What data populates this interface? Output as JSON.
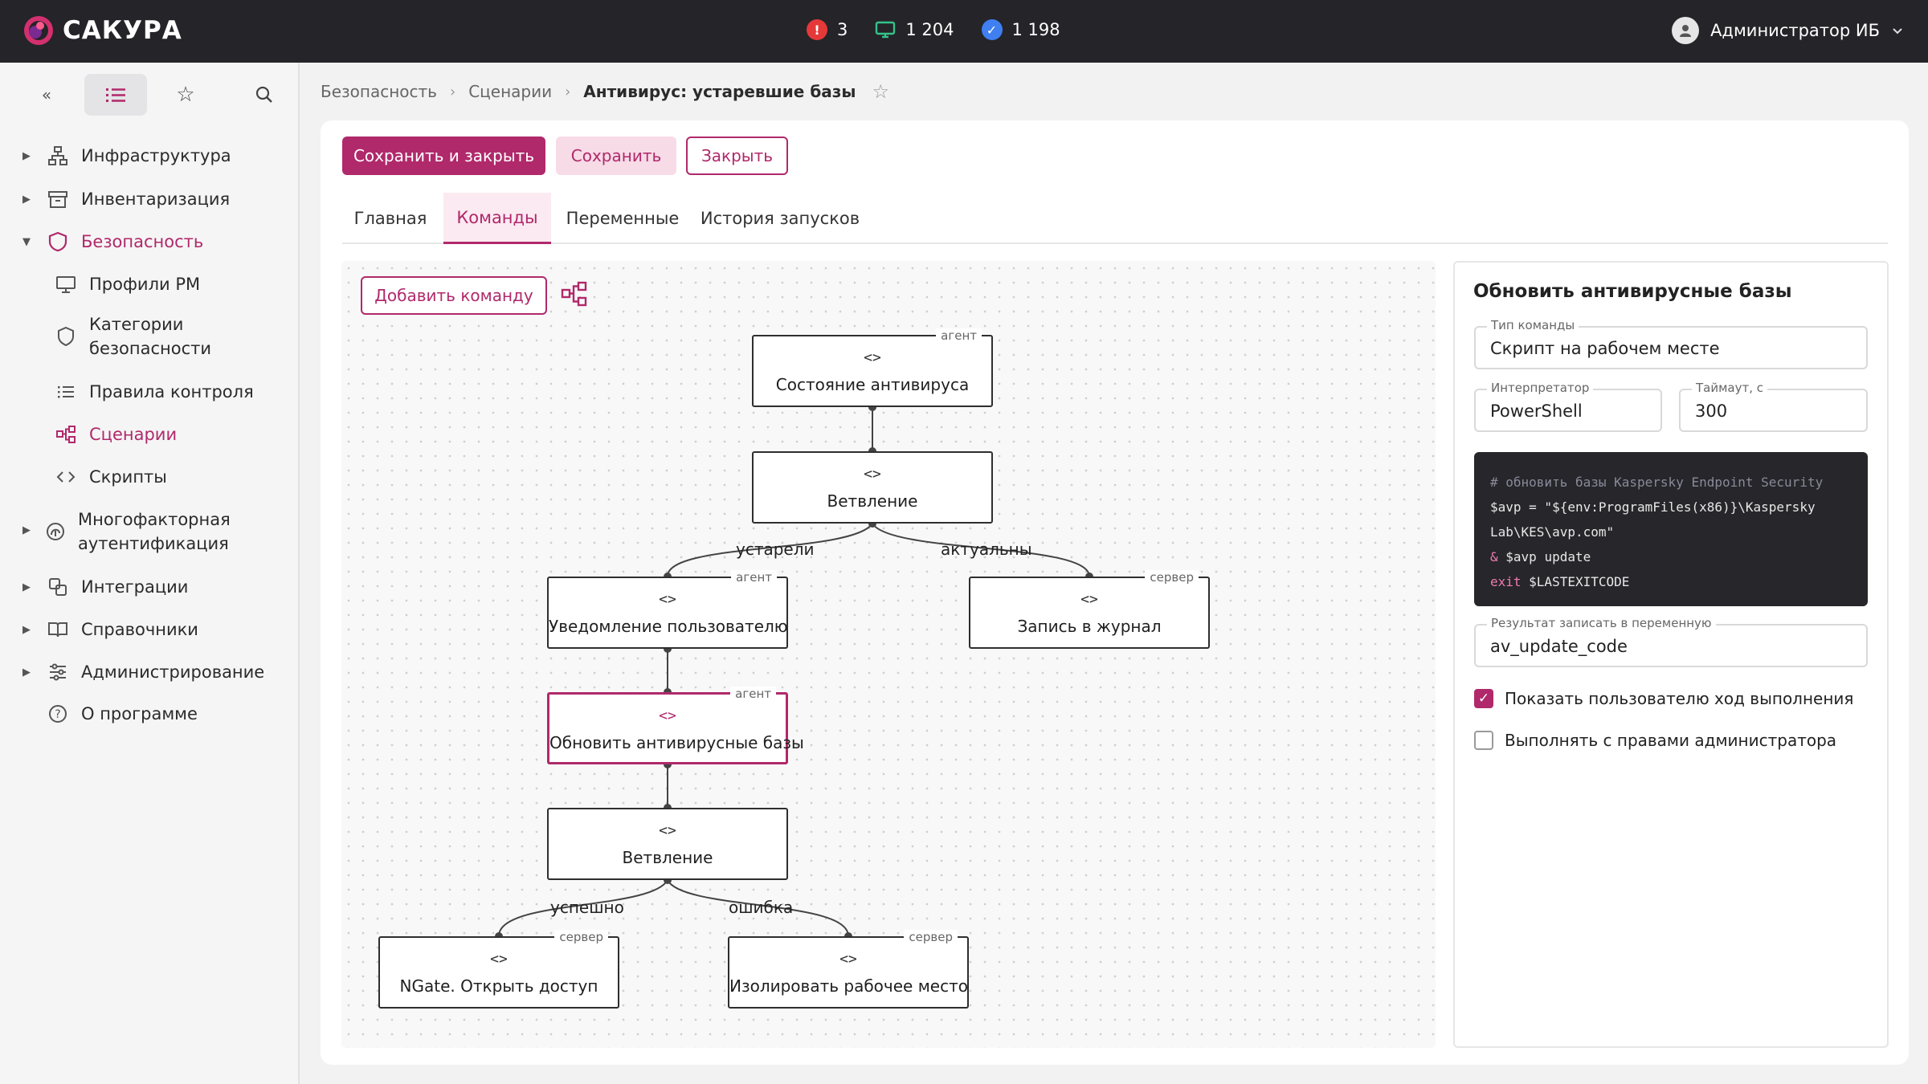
{
  "app": {
    "name": "САКУРА"
  },
  "stats": [
    {
      "icon": "alert-icon",
      "value": "3"
    },
    {
      "icon": "monitor-icon",
      "value": "1 204"
    },
    {
      "icon": "check-badge-icon",
      "value": "1 198"
    }
  ],
  "user": {
    "name": "Администратор ИБ"
  },
  "sidebar": {
    "items": [
      {
        "label": "Инфраструктура",
        "icon": "network-icon",
        "expandable": true
      },
      {
        "label": "Инвентаризация",
        "icon": "archive-icon",
        "expandable": true
      },
      {
        "label": "Безопасность",
        "icon": "shield-icon",
        "expandable": true,
        "expanded": true
      },
      {
        "label": "Профили РМ",
        "icon": "monitor-icon"
      },
      {
        "label": "Категории безопасности",
        "line1": "Категории",
        "line2": "безопасности",
        "icon": "shield-outline-icon"
      },
      {
        "label": "Правила контроля",
        "icon": "list-icon"
      },
      {
        "label": "Сценарии",
        "icon": "workflow-icon",
        "active": true
      },
      {
        "label": "Скрипты",
        "icon": "code-icon"
      },
      {
        "label": "Многофакторная аутентификация",
        "line1": "Многофакторная",
        "line2": "аутентификация",
        "icon": "fingerprint-icon",
        "expandable": true
      },
      {
        "label": "Интеграции",
        "icon": "integration-icon",
        "expandable": true
      },
      {
        "label": "Справочники",
        "icon": "book-icon",
        "expandable": true
      },
      {
        "label": "Администрирование",
        "icon": "sliders-icon",
        "expandable": true
      },
      {
        "label": "О программе",
        "icon": "help-icon"
      }
    ]
  },
  "breadcrumb": [
    "Безопасность",
    "Сценарии",
    "Антивирус: устаревшие базы"
  ],
  "toolbar": {
    "save_close": "Сохранить и закрыть",
    "save": "Сохранить",
    "close": "Закрыть"
  },
  "tabs": [
    "Главная",
    "Команды",
    "Переменные",
    "История запусков"
  ],
  "active_tab": "Команды",
  "canvas": {
    "add_command": "Добавить команду",
    "code_glyph": "<>",
    "nodes": [
      {
        "label": "Состояние антивируса",
        "tag": "агент"
      },
      {
        "label": "Ветвление",
        "tag": ""
      },
      {
        "label": "Уведомление пользователю",
        "tag": "агент"
      },
      {
        "label": "Запись в журнал",
        "tag": "сервер"
      },
      {
        "label": "Обновить антивирусные базы",
        "tag": "агент",
        "selected": true
      },
      {
        "label": "Ветвление",
        "tag": ""
      },
      {
        "label": "NGate. Открыть доступ",
        "tag": "сервер"
      },
      {
        "label": "Изолировать рабочее место",
        "tag": "сервер"
      }
    ],
    "edge_labels": [
      "устарели",
      "актуальны",
      "успешно",
      "ошибка"
    ]
  },
  "panel": {
    "title": "Обновить антивирусные базы",
    "type_label": "Тип команды",
    "type_value": "Скрипт на рабочем месте",
    "interpreter_label": "Интерпретатор",
    "interpreter_value": "PowerShell",
    "timeout_label": "Таймаут, с",
    "timeout_value": "300",
    "code": {
      "comment": "# обновить базы Kaspersky Endpoint Security",
      "line2": "$avp = \"${env:ProgramFiles(x86)}\\Kaspersky",
      "line3": "Lab\\KES\\avp.com\"",
      "line4_op": "&",
      "line4_rest": " $avp update",
      "line5_kw": "exit",
      "line5_rest": " $LASTEXITCODE"
    },
    "result_label": "Результат записать в переменную",
    "result_value": "av_update_code",
    "checkbox1": {
      "label": "Показать пользователю ход выполнения",
      "checked": true
    },
    "checkbox2": {
      "label": "Выполнять с правами администратора",
      "checked": false
    }
  },
  "colors": {
    "accent": "#b0296b",
    "topbar": "#242429",
    "alert": "#e53939",
    "ok": "#3f7ff0",
    "monitor": "#34c38a"
  }
}
